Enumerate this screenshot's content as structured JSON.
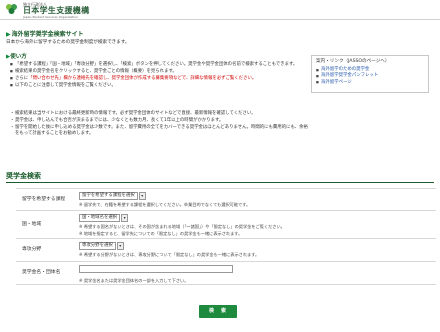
{
  "header": {
    "org_prefix": "独立行政法人",
    "org_name": "日本学生支援機構",
    "org_en": "Japan Student Services Organization",
    "logo_text": "JASSO"
  },
  "page_title": "海外留学奨学金検索サイト",
  "lead_text": "日本から海外に留学するための奨学金制度が検索できます。",
  "how_to": {
    "title": "使い方",
    "items": [
      {
        "text": "「希望する課程」「国・地域」「専攻分野」を選択し、「検索」ボタンを押してください。奨学金や奨学金団体の名前で検索することもできます。"
      },
      {
        "text": "検索結果の奨学金名をクリックすると、奨学金ごとの情報（概要）を見られます。"
      },
      {
        "text": "さらに「問い合わせ先」欄から連絡先を確認し、奨学金団体が作成する募集要項などで、詳細な情報を必ずご覧ください。",
        "has_red": true,
        "prefix": "さらに",
        "red": "「問い合わせ先」欄から連絡先を確認し、奨学金団体が作成する募集要項などで、詳細な情報を必ずご覧ください。"
      },
      {
        "text": "以下のことに注意して奨学金情報をご覧ください。"
      }
    ]
  },
  "links_box": {
    "title": "案内・リンク（JASSOのページへ）",
    "items": [
      "海外留学のための奨学金",
      "海外留学奨学金パンフレット",
      "海外留学ページ"
    ]
  },
  "notes": [
    "検索結果は当サイトにおける最終更新時の情報です。必ず奨学金団体のサイトなどで直接、最新情報を確認してください。",
    "奨学金は、申し込んでも合否が決まるまでには、少なくとも数カ月、長くて1年以上の時間がかかります。",
    "留学を開始した後に申し込める奨学金は少数です。また、留学費用の全てをカバーできる奨学金はほとんどありません。時間的にも費用的にも、余裕をもって計画することをお勧めします。"
  ],
  "search": {
    "heading": "奨学金検索",
    "rows": [
      {
        "label": "留学を希望する課程",
        "select": "留学を希望する課程を選択",
        "hint": "※ 留学先で、在籍を希望する課程を選択してください。卒業目的でなくても選択可能です。"
      },
      {
        "label": "国・地域",
        "select": "国・地域名を選択",
        "hint": "※ 希望する国名がないときは、その国が含まれる地域（「〜諸国」）や「限定なし」の奨学金をご覧ください。",
        "hint2": "※ 地域を指定すると、留学先についての「限定なし」の奨学金も一緒に表示されます。"
      },
      {
        "label": "専攻分野",
        "select": "専攻分野を選択",
        "hint": "※ 希望する分野がないときは、専攻分野について「限定なし」の奨学金も一緒に表示されます。"
      },
      {
        "label": "奨学金名・団体名",
        "input_placeholder": "",
        "hint": "※ 奨学金名または奨学金団体名の一部を入力して下さい。"
      }
    ],
    "button_label": "検　索"
  },
  "colors": {
    "brand_green": "#1e8a3d",
    "heading_green": "#1b5c2c",
    "link_blue": "#2255aa",
    "alert_red": "#d00000"
  }
}
